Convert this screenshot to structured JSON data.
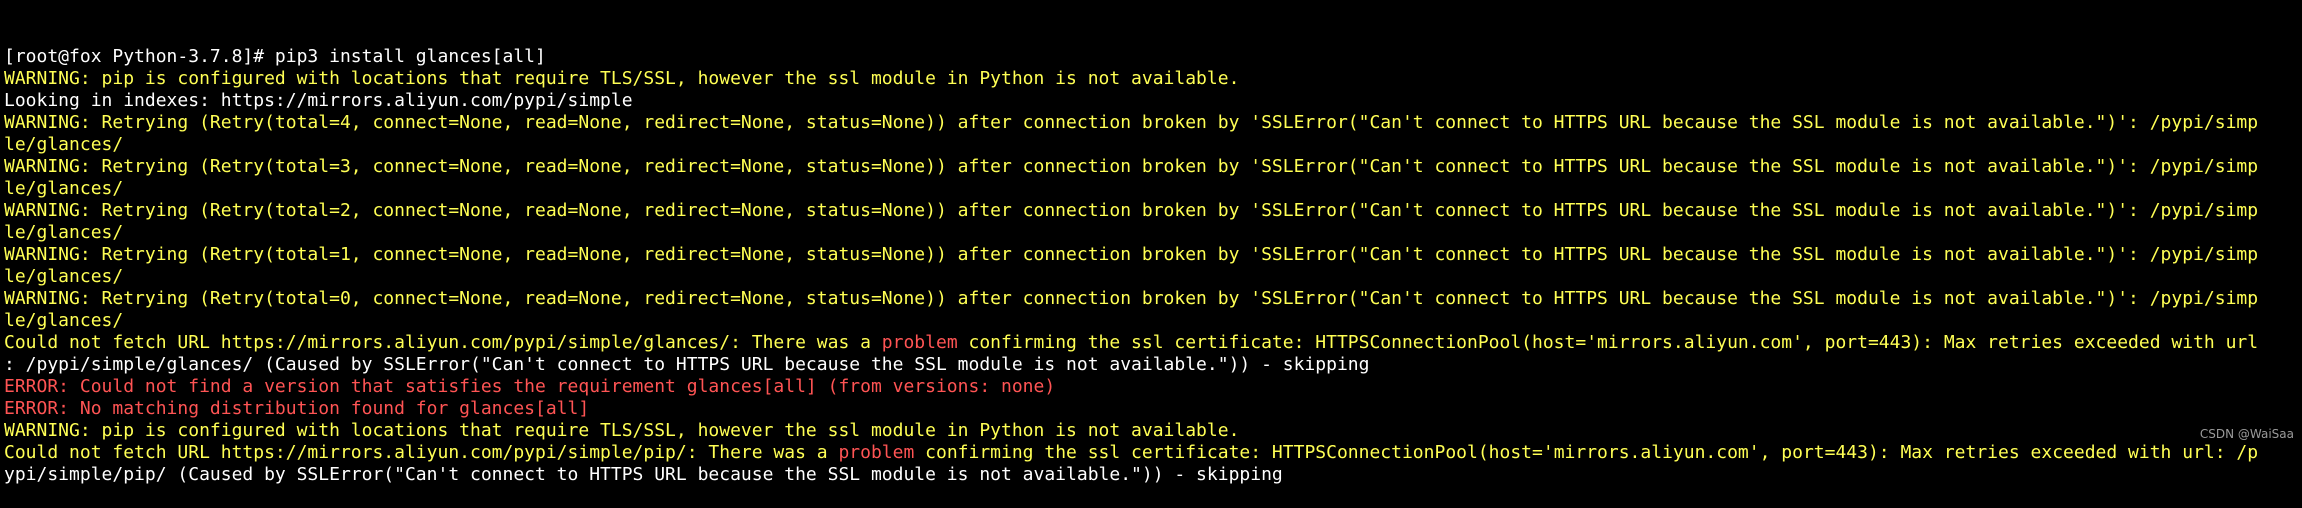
{
  "colors": {
    "background": "#000000",
    "default": "#ffffff",
    "warning": "#ffff54",
    "error": "#ff5454"
  },
  "terminal": {
    "lines": [
      [
        {
          "text": "[root@fox Python-3.7.8]# pip3 install glances[all]",
          "color": "white"
        }
      ],
      [
        {
          "text": "WARNING: pip is configured with locations that require TLS/SSL, however the ssl module in Python is not available.",
          "color": "yellow"
        }
      ],
      [
        {
          "text": "Looking in indexes: https://mirrors.aliyun.com/pypi/simple",
          "color": "white"
        }
      ],
      [
        {
          "text": "WARNING: Retrying (Retry(total=4, connect=None, read=None, redirect=None, status=None)) after connection broken by 'SSLError(\"Can't connect to HTTPS URL because the SSL module is not available.\")': /pypi/simp",
          "color": "yellow"
        }
      ],
      [
        {
          "text": "le/glances/",
          "color": "yellow"
        }
      ],
      [
        {
          "text": "WARNING: Retrying (Retry(total=3, connect=None, read=None, redirect=None, status=None)) after connection broken by 'SSLError(\"Can't connect to HTTPS URL because the SSL module is not available.\")': /pypi/simp",
          "color": "yellow"
        }
      ],
      [
        {
          "text": "le/glances/",
          "color": "yellow"
        }
      ],
      [
        {
          "text": "WARNING: Retrying (Retry(total=2, connect=None, read=None, redirect=None, status=None)) after connection broken by 'SSLError(\"Can't connect to HTTPS URL because the SSL module is not available.\")': /pypi/simp",
          "color": "yellow"
        }
      ],
      [
        {
          "text": "le/glances/",
          "color": "yellow"
        }
      ],
      [
        {
          "text": "WARNING: Retrying (Retry(total=1, connect=None, read=None, redirect=None, status=None)) after connection broken by 'SSLError(\"Can't connect to HTTPS URL because the SSL module is not available.\")': /pypi/simp",
          "color": "yellow"
        }
      ],
      [
        {
          "text": "le/glances/",
          "color": "yellow"
        }
      ],
      [
        {
          "text": "WARNING: Retrying (Retry(total=0, connect=None, read=None, redirect=None, status=None)) after connection broken by 'SSLError(\"Can't connect to HTTPS URL because the SSL module is not available.\")': /pypi/simp",
          "color": "yellow"
        }
      ],
      [
        {
          "text": "le/glances/",
          "color": "yellow"
        }
      ],
      [
        {
          "text": "Could not fetch URL https://mirrors.aliyun.com/pypi/simple/glances/: There was a ",
          "color": "yellow"
        },
        {
          "text": "problem",
          "color": "red"
        },
        {
          "text": " confirming the ssl certificate: HTTPSConnectionPool(host='mirrors.aliyun.com', port=443): Max retries exceeded with url",
          "color": "yellow"
        }
      ],
      [
        {
          "text": ": /pypi/simple/glances/ (Caused by SSLError(\"Can't connect to HTTPS URL because the SSL module is not available.\")) - skipping",
          "color": "white"
        }
      ],
      [
        {
          "text": "ERROR: Could not find a version that satisfies the requirement glances[all] (from versions: none)",
          "color": "red"
        }
      ],
      [
        {
          "text": "ERROR: No matching distribution found for glances[all]",
          "color": "red"
        }
      ],
      [
        {
          "text": "WARNING: pip is configured with locations that require TLS/SSL, however the ssl module in Python is not available.",
          "color": "yellow"
        }
      ],
      [
        {
          "text": "Could not fetch URL https://mirrors.aliyun.com/pypi/simple/pip/: There was a ",
          "color": "yellow"
        },
        {
          "text": "problem",
          "color": "red"
        },
        {
          "text": " confirming the ssl certificate: HTTPSConnectionPool(host='mirrors.aliyun.com', port=443): Max retries exceeded with url: /p",
          "color": "yellow"
        }
      ],
      [
        {
          "text": "ypi/simple/pip/ (Caused by SSLError(\"Can't connect to HTTPS URL because the SSL module is not available.\")) - skipping",
          "color": "white"
        }
      ]
    ]
  },
  "watermark": "CSDN @WaiSaa"
}
